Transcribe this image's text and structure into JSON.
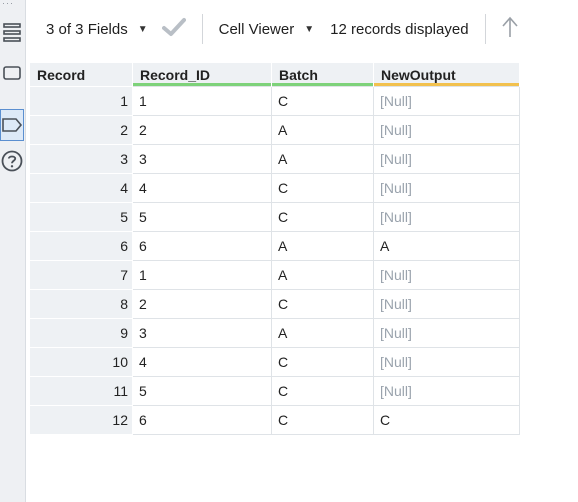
{
  "toolbar": {
    "fields_label": "3 of 3 Fields",
    "viewer_label": "Cell Viewer",
    "records_label": "12 records displayed"
  },
  "grid": {
    "headers": [
      "Record",
      "Record_ID",
      "Batch",
      "NewOutput"
    ],
    "header_underline_colors": [
      "#eef1f4",
      "#7ed27a",
      "#7ed27a",
      "#f2c14e"
    ],
    "rows": [
      {
        "record": "1",
        "record_id": "1",
        "batch": "C",
        "new_output": "[Null]",
        "is_null": true
      },
      {
        "record": "2",
        "record_id": "2",
        "batch": "A",
        "new_output": "[Null]",
        "is_null": true
      },
      {
        "record": "3",
        "record_id": "3",
        "batch": "A",
        "new_output": "[Null]",
        "is_null": true
      },
      {
        "record": "4",
        "record_id": "4",
        "batch": "C",
        "new_output": "[Null]",
        "is_null": true
      },
      {
        "record": "5",
        "record_id": "5",
        "batch": "C",
        "new_output": "[Null]",
        "is_null": true
      },
      {
        "record": "6",
        "record_id": "6",
        "batch": "A",
        "new_output": "A",
        "is_null": false
      },
      {
        "record": "7",
        "record_id": "1",
        "batch": "A",
        "new_output": "[Null]",
        "is_null": true
      },
      {
        "record": "8",
        "record_id": "2",
        "batch": "C",
        "new_output": "[Null]",
        "is_null": true
      },
      {
        "record": "9",
        "record_id": "3",
        "batch": "A",
        "new_output": "[Null]",
        "is_null": true
      },
      {
        "record": "10",
        "record_id": "4",
        "batch": "C",
        "new_output": "[Null]",
        "is_null": true
      },
      {
        "record": "11",
        "record_id": "5",
        "batch": "C",
        "new_output": "[Null]",
        "is_null": true
      },
      {
        "record": "12",
        "record_id": "6",
        "batch": "C",
        "new_output": "C",
        "is_null": false
      }
    ]
  },
  "icons": {
    "rail": [
      "list-icon",
      "rectangle-icon",
      "tag-icon",
      "help-icon"
    ],
    "toolbar": [
      "caret-down-icon",
      "checkmark-icon",
      "caret-down-icon",
      "up-arrow-icon"
    ]
  },
  "colors": {
    "null_text": "#9aa3ad",
    "header_bg": "#eef1f4",
    "check_gray": "#b9bfc6"
  }
}
